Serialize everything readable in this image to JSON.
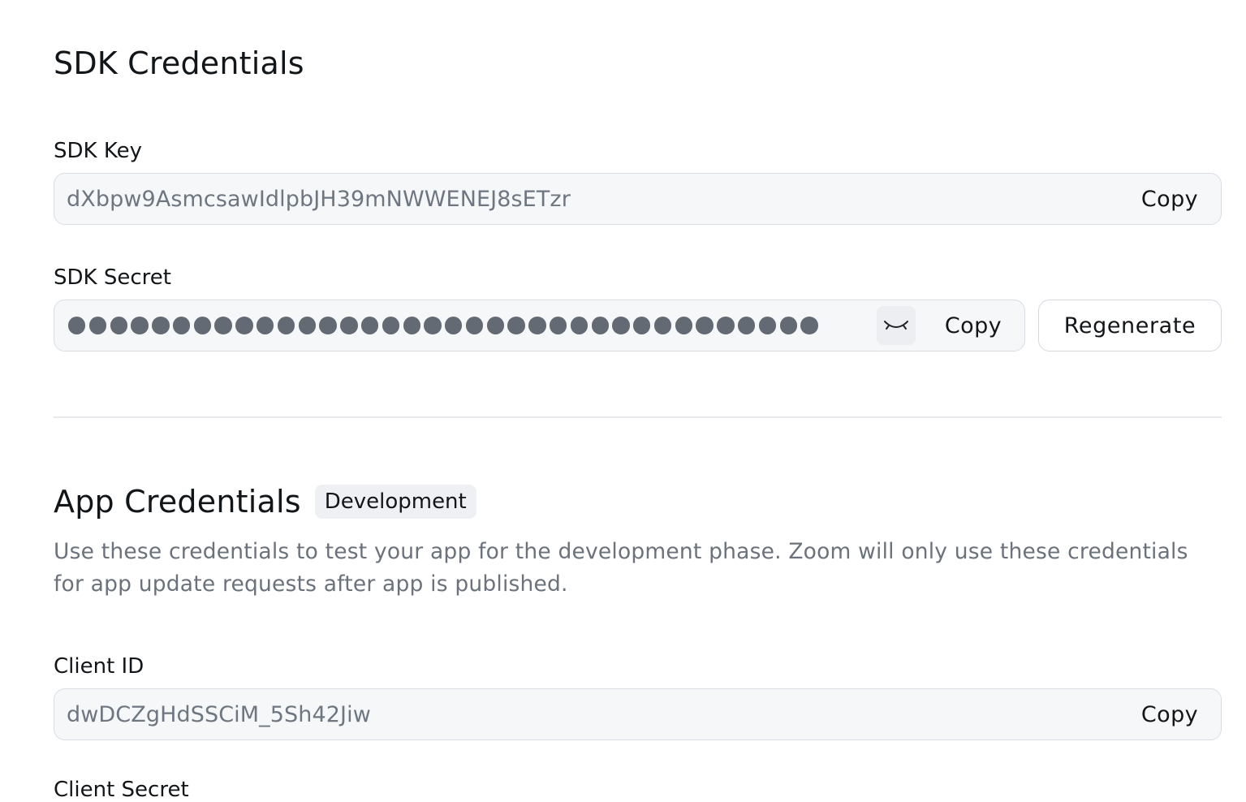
{
  "sdk_credentials": {
    "title": "SDK Credentials",
    "sdk_key": {
      "label": "SDK Key",
      "value": "dXbpw9AsmcsawIdlpbJH39mNWWENEJ8sETzr",
      "copy_label": "Copy"
    },
    "sdk_secret": {
      "label": "SDK Secret",
      "masked_dot_count": 36,
      "visibility_icon": "eye-closed-icon",
      "copy_label": "Copy",
      "regenerate_label": "Regenerate"
    }
  },
  "app_credentials": {
    "title": "App Credentials",
    "badge": "Development",
    "description": "Use these credentials to test your app for the development phase. Zoom will only use these credentials for app update requests after app is published.",
    "client_id": {
      "label": "Client ID",
      "value": "dwDCZgHdSSCiM_5Sh42Jiw",
      "copy_label": "Copy"
    },
    "client_secret": {
      "label": "Client Secret"
    }
  }
}
